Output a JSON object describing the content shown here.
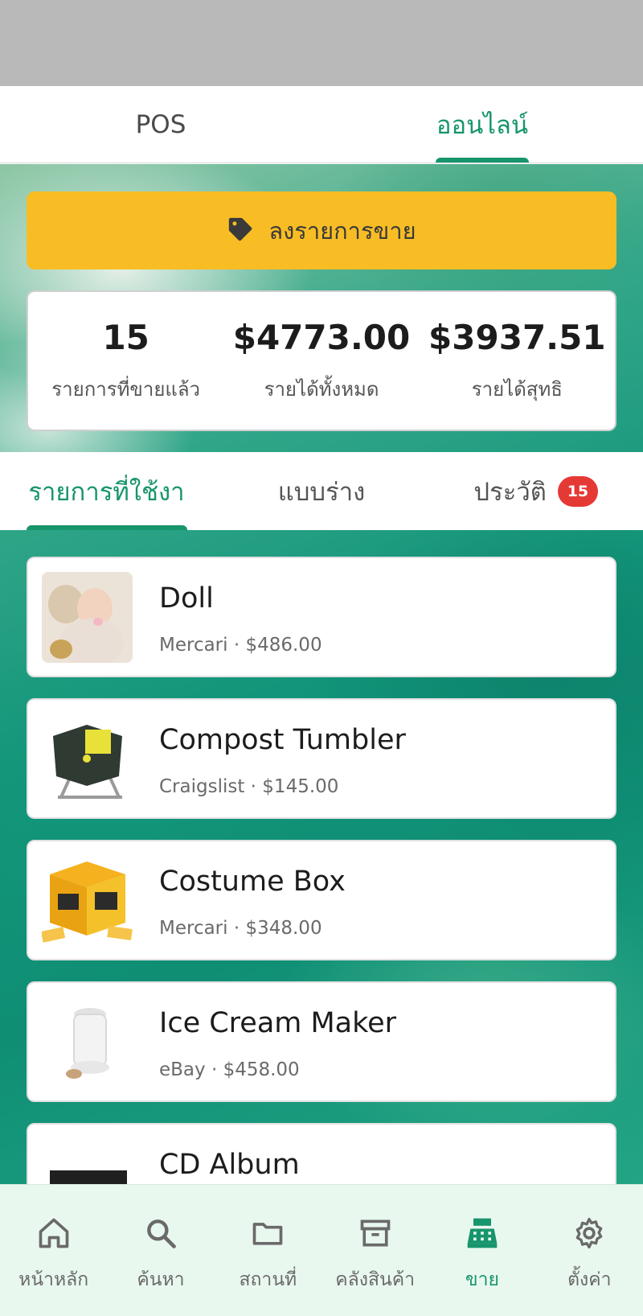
{
  "top_tabs": [
    {
      "label": "POS",
      "active": false
    },
    {
      "label": "ออนไลน์",
      "active": true
    }
  ],
  "post_listing": {
    "label": "ลงรายการขาย",
    "icon": "tag-icon"
  },
  "stats": [
    {
      "value": "15",
      "label": "รายการที่ขายแล้ว"
    },
    {
      "value": "$4773.00",
      "label": "รายได้ทั้งหมด"
    },
    {
      "value": "$3937.51",
      "label": "รายได้สุทธิ"
    }
  ],
  "sub_tabs": [
    {
      "label": "รายการที่ใช้งาน",
      "active": true
    },
    {
      "label": "แบบร่าง",
      "active": false
    },
    {
      "label": "ประวัติ",
      "active": false,
      "badge": "15"
    }
  ],
  "listings": [
    {
      "title": "Doll",
      "subtitle": "Mercari · $486.00",
      "thumb": "baby-doll-photo"
    },
    {
      "title": "Compost Tumbler",
      "subtitle": "Craigslist · $145.00",
      "thumb": "compost-tumbler-photo"
    },
    {
      "title": "Costume Box",
      "subtitle": "Mercari · $348.00",
      "thumb": "costume-box-photo"
    },
    {
      "title": "Ice Cream Maker",
      "subtitle": "eBay · $458.00",
      "thumb": "ice-cream-maker-photo"
    },
    {
      "title": "CD Album",
      "subtitle": "",
      "thumb": "cd-album-photo"
    }
  ],
  "bottom_nav": [
    {
      "label": "หน้าหลัก",
      "icon": "home-icon",
      "active": false
    },
    {
      "label": "ค้นหา",
      "icon": "search-icon",
      "active": false
    },
    {
      "label": "สถานที่",
      "icon": "folder-icon",
      "active": false
    },
    {
      "label": "คลังสินค้า",
      "icon": "archive-icon",
      "active": false
    },
    {
      "label": "ขาย",
      "icon": "cash-register-icon",
      "active": true
    },
    {
      "label": "ตั้งค่า",
      "icon": "gear-icon",
      "active": false
    }
  ],
  "colors": {
    "accent": "#17956c",
    "button_yellow": "#f8bd25",
    "badge_red": "#e53935",
    "nav_background": "#e9f8ef"
  }
}
